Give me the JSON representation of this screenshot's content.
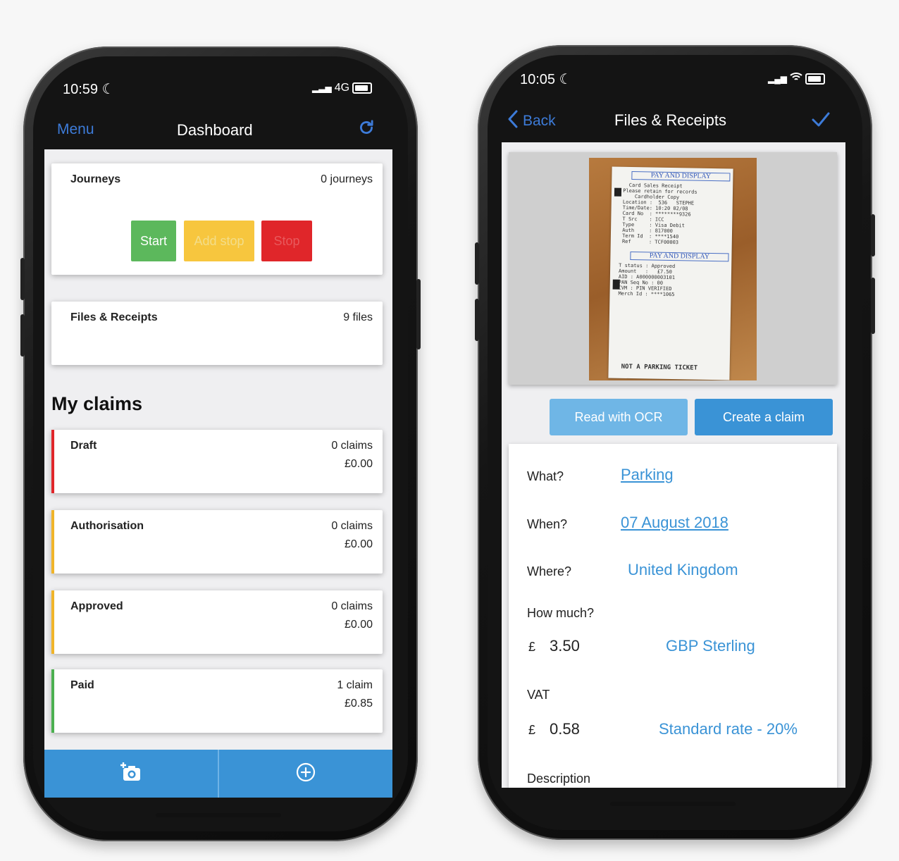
{
  "left_phone": {
    "status": {
      "time": "10:59",
      "network": "4G"
    },
    "nav": {
      "menu": "Menu",
      "title": "Dashboard"
    },
    "journeys": {
      "title": "Journeys",
      "count": "0 journeys",
      "start": "Start",
      "add_stop": "Add stop",
      "stop": "Stop"
    },
    "files": {
      "title": "Files & Receipts",
      "count": "9 files"
    },
    "claims_heading": "My claims",
    "claims": [
      {
        "label": "Draft",
        "count": "0 claims",
        "amount": "£0.00",
        "color": "#e0262a"
      },
      {
        "label": "Authorisation",
        "count": "0 claims",
        "amount": "£0.00",
        "color": "#f0b429"
      },
      {
        "label": "Approved",
        "count": "0 claims",
        "amount": "£0.00",
        "color": "#f0b429"
      },
      {
        "label": "Paid",
        "count": "1 claim",
        "amount": "£0.85",
        "color": "#4cb050"
      }
    ],
    "bottom_tabs": {
      "camera": "add-photo-icon",
      "add": "add-circle-icon"
    }
  },
  "right_phone": {
    "status": {
      "time": "10:05"
    },
    "nav": {
      "back": "Back",
      "title": "Files & Receipts"
    },
    "receipt": {
      "header1": "PAY AND DISPLAY",
      "header2": "PAY AND DISPLAY",
      "footer": "NOT A PARKING TICKET"
    },
    "buttons": {
      "ocr": "Read with OCR",
      "create": "Create a claim"
    },
    "details": {
      "what_label": "What?",
      "what_value": "Parking",
      "when_label": "When?",
      "when_value": "07 August 2018",
      "where_label": "Where?",
      "where_value": "United Kingdom",
      "how_much_label": "How much?",
      "currency_symbol": "£",
      "amount": "3.50",
      "currency": "GBP Sterling",
      "vat_label": "VAT",
      "vat_symbol": "£",
      "vat_amount": "0.58",
      "vat_rate": "Standard rate - 20%",
      "description_label": "Description"
    }
  },
  "colors": {
    "accent": "#3a93d6",
    "nav_link": "#3d7bd8",
    "start": "#5cb85c",
    "add_stop": "#f7c63e",
    "stop": "#e0262a"
  }
}
